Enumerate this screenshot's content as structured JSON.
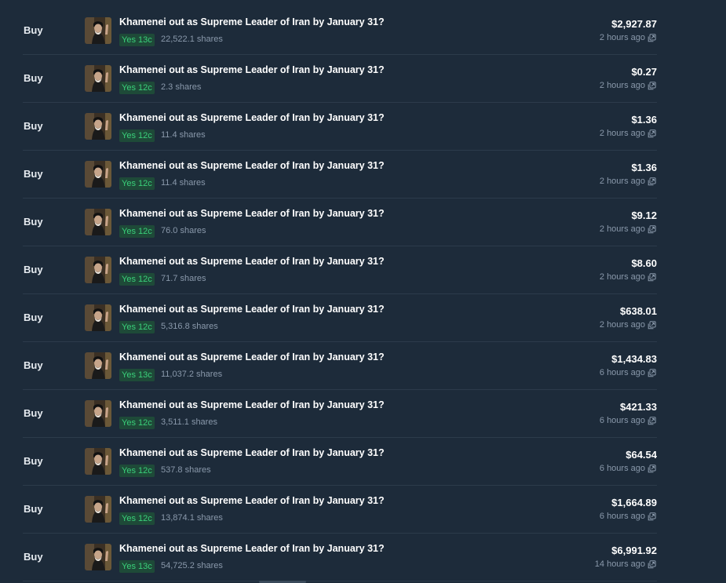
{
  "activity": {
    "rows": [
      {
        "side": "Buy",
        "title": "Khamenei out as Supreme Leader of Iran by January 31?",
        "outcome": "Yes 13c",
        "shares": "22,522.1 shares",
        "amount": "$2,927.87",
        "time": "2 hours ago"
      },
      {
        "side": "Buy",
        "title": "Khamenei out as Supreme Leader of Iran by January 31?",
        "outcome": "Yes 12c",
        "shares": "2.3 shares",
        "amount": "$0.27",
        "time": "2 hours ago"
      },
      {
        "side": "Buy",
        "title": "Khamenei out as Supreme Leader of Iran by January 31?",
        "outcome": "Yes 12c",
        "shares": "11.4 shares",
        "amount": "$1.36",
        "time": "2 hours ago"
      },
      {
        "side": "Buy",
        "title": "Khamenei out as Supreme Leader of Iran by January 31?",
        "outcome": "Yes 12c",
        "shares": "11.4 shares",
        "amount": "$1.36",
        "time": "2 hours ago"
      },
      {
        "side": "Buy",
        "title": "Khamenei out as Supreme Leader of Iran by January 31?",
        "outcome": "Yes 12c",
        "shares": "76.0 shares",
        "amount": "$9.12",
        "time": "2 hours ago"
      },
      {
        "side": "Buy",
        "title": "Khamenei out as Supreme Leader of Iran by January 31?",
        "outcome": "Yes 12c",
        "shares": "71.7 shares",
        "amount": "$8.60",
        "time": "2 hours ago"
      },
      {
        "side": "Buy",
        "title": "Khamenei out as Supreme Leader of Iran by January 31?",
        "outcome": "Yes 12c",
        "shares": "5,316.8 shares",
        "amount": "$638.01",
        "time": "2 hours ago"
      },
      {
        "side": "Buy",
        "title": "Khamenei out as Supreme Leader of Iran by January 31?",
        "outcome": "Yes 13c",
        "shares": "11,037.2 shares",
        "amount": "$1,434.83",
        "time": "6 hours ago"
      },
      {
        "side": "Buy",
        "title": "Khamenei out as Supreme Leader of Iran by January 31?",
        "outcome": "Yes 12c",
        "shares": "3,511.1 shares",
        "amount": "$421.33",
        "time": "6 hours ago"
      },
      {
        "side": "Buy",
        "title": "Khamenei out as Supreme Leader of Iran by January 31?",
        "outcome": "Yes 12c",
        "shares": "537.8 shares",
        "amount": "$64.54",
        "time": "6 hours ago"
      },
      {
        "side": "Buy",
        "title": "Khamenei out as Supreme Leader of Iran by January 31?",
        "outcome": "Yes 12c",
        "shares": "13,874.1 shares",
        "amount": "$1,664.89",
        "time": "6 hours ago"
      },
      {
        "side": "Buy",
        "title": "Khamenei out as Supreme Leader of Iran by January 31?",
        "outcome": "Yes 13c",
        "shares": "54,725.2 shares",
        "amount": "$6,991.92",
        "time": "14 hours ago"
      }
    ]
  },
  "icons": {
    "thumbnail": "market-thumbnail-icon",
    "link": "external-link-icon"
  },
  "colors": {
    "background": "#1d2b3a",
    "yes_text": "#3ad07a",
    "yes_bg": "#1e4a38",
    "muted": "#8a99ab",
    "divider": "#2c3b4b"
  }
}
